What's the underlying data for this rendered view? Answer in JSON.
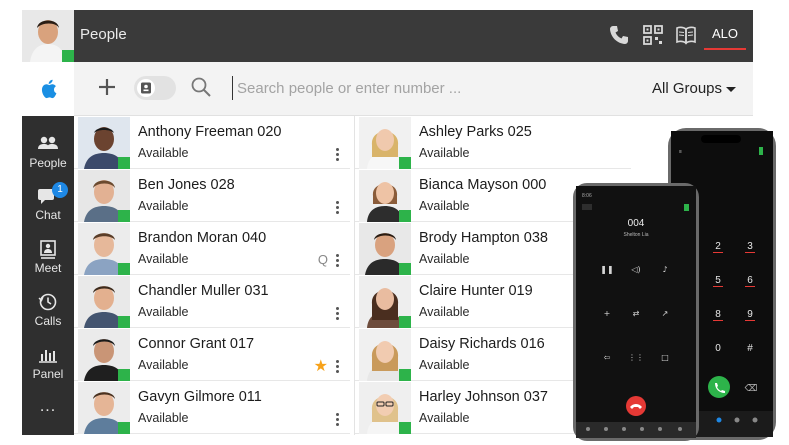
{
  "app": {
    "section_title": "People",
    "header_button": "ALO"
  },
  "rail": {
    "items": [
      {
        "label": "People",
        "icon": "people-icon"
      },
      {
        "label": "Chat",
        "icon": "chat-icon",
        "badge": "1"
      },
      {
        "label": "Meet",
        "icon": "meet-icon"
      },
      {
        "label": "Calls",
        "icon": "calls-history-icon"
      },
      {
        "label": "Panel",
        "icon": "panel-icon"
      }
    ],
    "more": "..."
  },
  "search": {
    "placeholder": "Search people or enter number ...",
    "groups_label": "All Groups"
  },
  "contacts_left": [
    {
      "name": "Anthony Freeman 020",
      "status": "Available"
    },
    {
      "name": "Ben Jones 028",
      "status": "Available"
    },
    {
      "name": "Brandon Moran 040",
      "status": "Available"
    },
    {
      "name": "Chandler Muller 031",
      "status": "Available"
    },
    {
      "name": "Connor Grant 017",
      "status": "Available"
    },
    {
      "name": "Gavyn Gilmore 011",
      "status": "Available"
    }
  ],
  "contacts_right": [
    {
      "name": "Ashley Parks 025",
      "status": "Available"
    },
    {
      "name": "Bianca Mayson 000",
      "status": "Available"
    },
    {
      "name": "Brody Hampton 038",
      "status": "Available"
    },
    {
      "name": "Claire Hunter 019",
      "status": "Available"
    },
    {
      "name": "Daisy Richards 016",
      "status": "Available"
    },
    {
      "name": "Harley Johnson 037",
      "status": "Available"
    }
  ],
  "phone_front": {
    "number": "004",
    "caller": "Shelton Lia"
  },
  "colors": {
    "presence": "#2db34a",
    "accent": "#e53935",
    "favorite": "#f7a21a"
  }
}
